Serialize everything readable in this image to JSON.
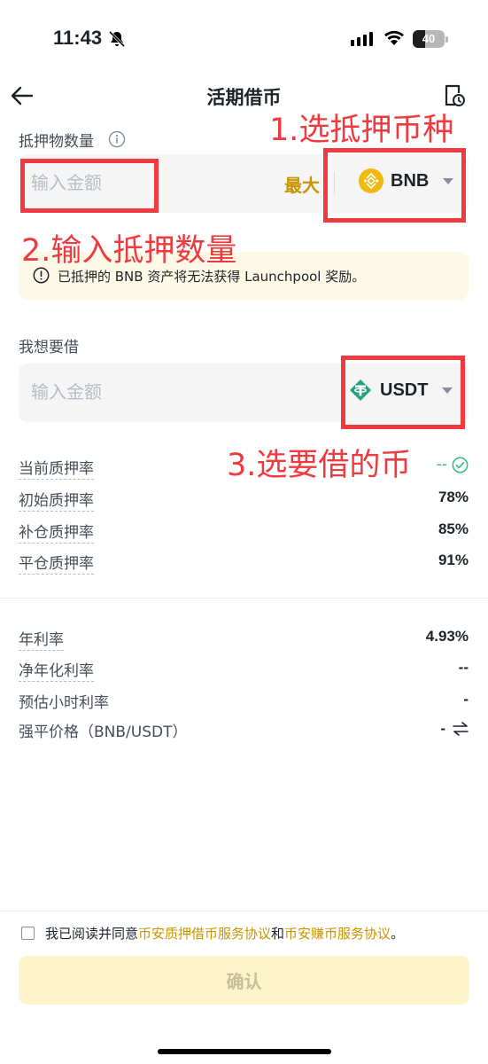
{
  "status_bar": {
    "time": "11:43",
    "battery": "40",
    "battery_level": 0.4
  },
  "nav": {
    "title": "活期借币"
  },
  "collateral": {
    "label": "抵押物数量",
    "placeholder": "输入金额",
    "max_label": "最大",
    "coin": "BNB"
  },
  "notice": {
    "text": "已抵押的 BNB 资产将无法获得 Launchpool 奖励。"
  },
  "borrow": {
    "label": "我想要借",
    "placeholder": "输入金额",
    "coin": "USDT"
  },
  "ltv": [
    {
      "label": "当前质押率",
      "value": "--"
    },
    {
      "label": "初始质押率",
      "value": "78%"
    },
    {
      "label": "补仓质押率",
      "value": "85%"
    },
    {
      "label": "平仓质押率",
      "value": "91%"
    }
  ],
  "rates": [
    {
      "label": "年利率",
      "value": "4.93%"
    },
    {
      "label": "净年化利率",
      "value": "--"
    },
    {
      "label": "预估小时利率",
      "value": "-"
    },
    {
      "label": "强平价格（BNB/USDT）",
      "value": "-"
    }
  ],
  "agreement": {
    "prefix": "我已阅读并同意",
    "link1": "币安质押借币服务协议",
    "and": "和",
    "link2": "币安赚币服务协议",
    "suffix": "。"
  },
  "confirm_label": "确认",
  "annotations": {
    "step1": "1.选抵押币种",
    "step2": "2.输入抵押数量",
    "step3": "3.选要借的币"
  },
  "colors": {
    "accent": "#c99400",
    "annotation": "#ef3a3f",
    "bnb": "#f0b90b",
    "usdt": "#26a17b",
    "success": "#2ebd85"
  }
}
